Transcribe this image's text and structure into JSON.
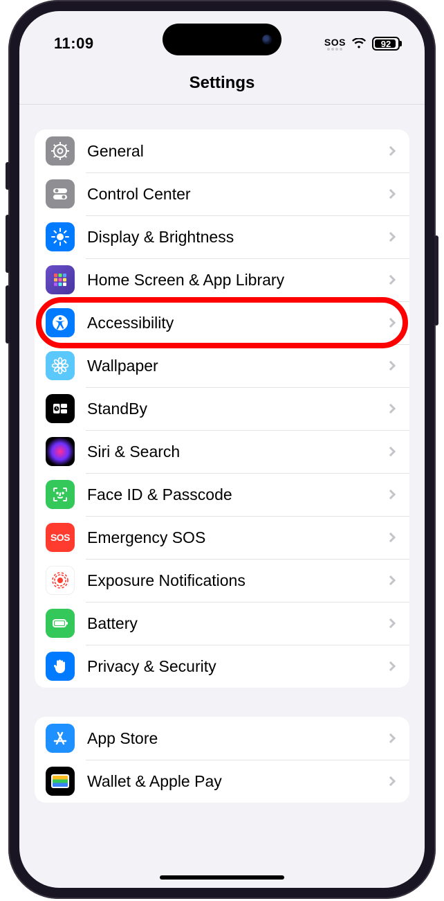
{
  "status": {
    "time": "11:09",
    "sos": "SOS",
    "battery": "92"
  },
  "nav": {
    "title": "Settings"
  },
  "groups": [
    {
      "items": [
        {
          "label": "General",
          "icon": "gear-icon"
        },
        {
          "label": "Control Center",
          "icon": "toggles-icon"
        },
        {
          "label": "Display & Brightness",
          "icon": "sun-icon"
        },
        {
          "label": "Home Screen & App Library",
          "icon": "grid-icon"
        },
        {
          "label": "Accessibility",
          "icon": "accessibility-icon",
          "highlighted": true
        },
        {
          "label": "Wallpaper",
          "icon": "flower-icon"
        },
        {
          "label": "StandBy",
          "icon": "clock-squares-icon"
        },
        {
          "label": "Siri & Search",
          "icon": "siri-icon"
        },
        {
          "label": "Face ID & Passcode",
          "icon": "faceid-icon"
        },
        {
          "label": "Emergency SOS",
          "icon": "sos-icon"
        },
        {
          "label": "Exposure Notifications",
          "icon": "exposure-icon"
        },
        {
          "label": "Battery",
          "icon": "battery-icon"
        },
        {
          "label": "Privacy & Security",
          "icon": "hand-icon"
        }
      ]
    },
    {
      "items": [
        {
          "label": "App Store",
          "icon": "appstore-icon"
        },
        {
          "label": "Wallet & Apple Pay",
          "icon": "wallet-icon"
        }
      ]
    }
  ]
}
